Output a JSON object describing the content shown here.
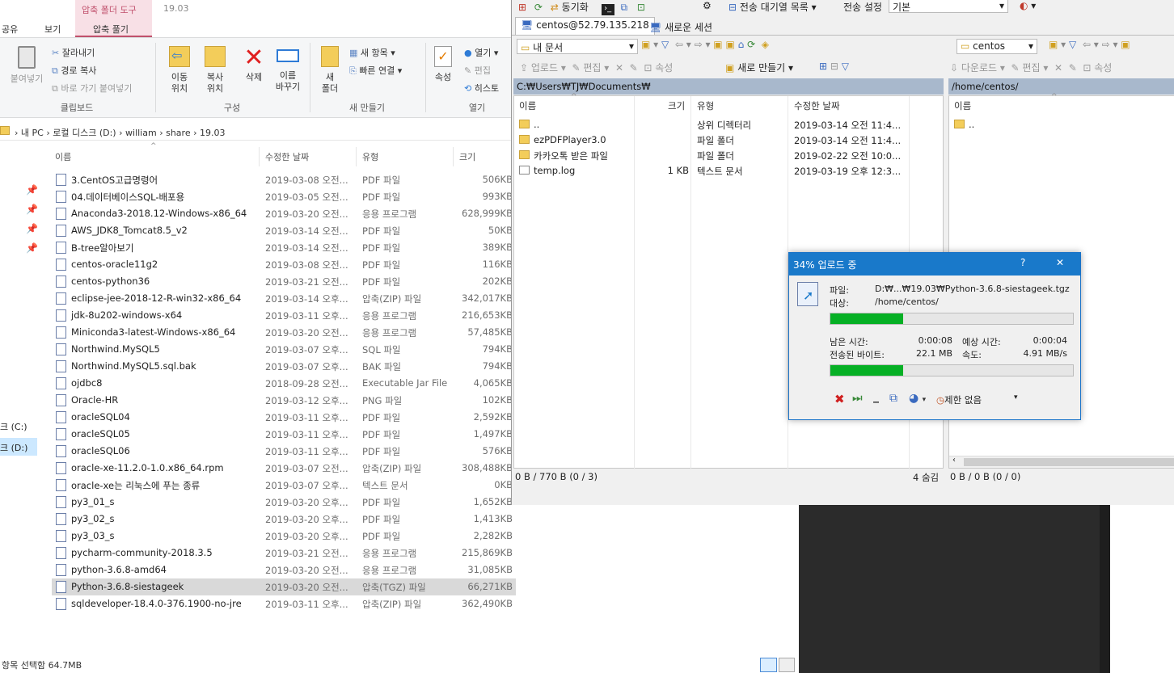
{
  "explorer": {
    "title": "19.03",
    "context_tab": "압축 폴더 도구",
    "tabs": [
      "공유",
      "보기",
      "압축 풀기"
    ],
    "ribbon": {
      "paste": "붙여넣기",
      "cut": "잘라내기",
      "copy_path": "경로 복사",
      "paste_shortcut": "바로 가기 붙여넣기",
      "move_to": "이동\n위치",
      "copy_to": "복사\n위치",
      "delete": "삭제",
      "rename": "이름\n바꾸기",
      "new_folder": "새\n폴더",
      "new_item": "새 항목",
      "easy_access": "빠른 연결",
      "properties": "속성",
      "open": "열기",
      "edit": "편집",
      "history": "히스토",
      "group_clipboard": "클립보드",
      "group_organize": "구성",
      "group_new": "새 만들기",
      "group_open": "열기"
    },
    "breadcrumb": [
      "내 PC",
      "로컬 디스크 (D:)",
      "william",
      "share",
      "19.03"
    ],
    "columns": {
      "name": "이름",
      "date": "수정한 날짜",
      "type": "유형",
      "size": "크기"
    },
    "nav_drives": [
      "크 (C:)",
      "크 (D:)"
    ],
    "files": [
      {
        "name": "3.CentOS고급명령어",
        "date": "2019-03-08 오전...",
        "type": "PDF 파일",
        "size": "506KB",
        "icon": "pdf-icon"
      },
      {
        "name": "04.데이터베이스SQL-배포용",
        "date": "2019-03-05 오전...",
        "type": "PDF 파일",
        "size": "993KB",
        "icon": "pdf-icon"
      },
      {
        "name": "Anaconda3-2018.12-Windows-x86_64",
        "date": "2019-03-20 오전...",
        "type": "응용 프로그램",
        "size": "628,999KB",
        "icon": "app-icon"
      },
      {
        "name": "AWS_JDK8_Tomcat8.5_v2",
        "date": "2019-03-14 오전...",
        "type": "PDF 파일",
        "size": "50KB",
        "icon": "pdf-icon"
      },
      {
        "name": "B-tree알아보기",
        "date": "2019-03-14 오전...",
        "type": "PDF 파일",
        "size": "389KB",
        "icon": "pdf-icon"
      },
      {
        "name": "centos-oracle11g2",
        "date": "2019-03-08 오전...",
        "type": "PDF 파일",
        "size": "116KB",
        "icon": "pdf-icon"
      },
      {
        "name": "centos-python36",
        "date": "2019-03-21 오전...",
        "type": "PDF 파일",
        "size": "202KB",
        "icon": "pdf-icon"
      },
      {
        "name": "eclipse-jee-2018-12-R-win32-x86_64",
        "date": "2019-03-14 오후...",
        "type": "압축(ZIP) 파일",
        "size": "342,017KB",
        "icon": "zip-icon"
      },
      {
        "name": "jdk-8u202-windows-x64",
        "date": "2019-03-11 오후...",
        "type": "응용 프로그램",
        "size": "216,653KB",
        "icon": "app-icon"
      },
      {
        "name": "Miniconda3-latest-Windows-x86_64",
        "date": "2019-03-20 오전...",
        "type": "응용 프로그램",
        "size": "57,485KB",
        "icon": "app-icon"
      },
      {
        "name": "Northwind.MySQL5",
        "date": "2019-03-07 오후...",
        "type": "SQL 파일",
        "size": "794KB",
        "icon": "sql-icon"
      },
      {
        "name": "Northwind.MySQL5.sql.bak",
        "date": "2019-03-07 오후...",
        "type": "BAK 파일",
        "size": "794KB",
        "icon": "file-icon"
      },
      {
        "name": "ojdbc8",
        "date": "2018-09-28 오전...",
        "type": "Executable Jar File",
        "size": "4,065KB",
        "icon": "jar-icon"
      },
      {
        "name": "Oracle-HR",
        "date": "2019-03-12 오후...",
        "type": "PNG 파일",
        "size": "102KB",
        "icon": "png-icon"
      },
      {
        "name": "oracleSQL04",
        "date": "2019-03-11 오후...",
        "type": "PDF 파일",
        "size": "2,592KB",
        "icon": "pdf-icon"
      },
      {
        "name": "oracleSQL05",
        "date": "2019-03-11 오후...",
        "type": "PDF 파일",
        "size": "1,497KB",
        "icon": "pdf-icon"
      },
      {
        "name": "oracleSQL06",
        "date": "2019-03-11 오후...",
        "type": "PDF 파일",
        "size": "576KB",
        "icon": "pdf-icon"
      },
      {
        "name": "oracle-xe-11.2.0-1.0.x86_64.rpm",
        "date": "2019-03-07 오전...",
        "type": "압축(ZIP) 파일",
        "size": "308,488KB",
        "icon": "zip-icon"
      },
      {
        "name": "oracle-xe는 리눅스에 푸는 종류",
        "date": "2019-03-07 오후...",
        "type": "텍스트 문서",
        "size": "0KB",
        "icon": "txt-icon"
      },
      {
        "name": "py3_01_s",
        "date": "2019-03-20 오후...",
        "type": "PDF 파일",
        "size": "1,652KB",
        "icon": "pdf-icon"
      },
      {
        "name": "py3_02_s",
        "date": "2019-03-20 오후...",
        "type": "PDF 파일",
        "size": "1,413KB",
        "icon": "pdf-icon"
      },
      {
        "name": "py3_03_s",
        "date": "2019-03-20 오후...",
        "type": "PDF 파일",
        "size": "2,282KB",
        "icon": "pdf-icon"
      },
      {
        "name": "pycharm-community-2018.3.5",
        "date": "2019-03-21 오전...",
        "type": "응용 프로그램",
        "size": "215,869KB",
        "icon": "pycharm-icon"
      },
      {
        "name": "python-3.6.8-amd64",
        "date": "2019-03-20 오전...",
        "type": "응용 프로그램",
        "size": "31,085KB",
        "icon": "python-icon"
      },
      {
        "name": "Python-3.6.8-siestageek",
        "date": "2019-03-20 오전...",
        "type": "압축(TGZ) 파일",
        "size": "66,271KB",
        "icon": "tgz-icon",
        "selected": true
      },
      {
        "name": "sqldeveloper-18.4.0-376.1900-no-jre",
        "date": "2019-03-11 오후...",
        "type": "압축(ZIP) 파일",
        "size": "362,490KB",
        "icon": "zip-icon"
      }
    ],
    "status": "항목 선택함 64.7MB"
  },
  "ftp": {
    "toolbar": {
      "sync": "동기화",
      "queue": "전송 대기열 목록",
      "transfer_settings": "전송 설정",
      "transfer_value": "기본"
    },
    "session_tab": "centos@52.79.135.218",
    "new_session": "새로운 세션",
    "local": {
      "location": "내 문서",
      "upload": "업로드",
      "edit": "편집",
      "props": "속성",
      "new": "새로 만들기",
      "path": "C:₩Users₩TJ₩Documents₩",
      "columns": {
        "name": "이름",
        "size": "크기",
        "type": "유형",
        "date": "수정한 날짜"
      },
      "rows": [
        {
          "name": "..",
          "size": "",
          "type": "상위 디렉터리",
          "date": "2019-03-14  오전 11:4..."
        },
        {
          "name": "ezPDFPlayer3.0",
          "size": "",
          "type": "파일 폴더",
          "date": "2019-03-14  오전 11:4..."
        },
        {
          "name": "카카오톡 받은 파일",
          "size": "",
          "type": "파일 폴더",
          "date": "2019-02-22  오전 10:0..."
        },
        {
          "name": "temp.log",
          "size": "1 KB",
          "type": "텍스트 문서",
          "date": "2019-03-19  오후 12:3..."
        }
      ],
      "status": "0 B / 770 B (0 / 3)",
      "hidden": "4 숨김"
    },
    "remote": {
      "location": "centos",
      "download": "다운로드",
      "edit": "편집",
      "props": "속성",
      "path": "/home/centos/",
      "columns": {
        "name": "이름"
      },
      "rows": [
        {
          "name": ".."
        }
      ],
      "status": "0 B / 0 B (0 / 0)"
    }
  },
  "dialog": {
    "title": "34% 업로드 중",
    "help": "?",
    "close": "✕",
    "file_label": "파일:",
    "file_value": "D:₩...₩19.03₩Python-3.6.8-siestageek.tgz",
    "target_label": "대상:",
    "target_value": "/home/centos/",
    "progress1": 0.3,
    "time_left_label": "남은 시간:",
    "time_left": "0:00:08",
    "est_label": "예상 시간:",
    "est": "0:00:04",
    "bytes_label": "전송된 바이트:",
    "bytes": "22.1 MB",
    "speed_label": "속도:",
    "speed": "4.91 MB/s",
    "progress2": 0.3,
    "limit": "제한 없음",
    "colors": {
      "title_bar": "#1979ca",
      "progress": "#06b025"
    }
  }
}
